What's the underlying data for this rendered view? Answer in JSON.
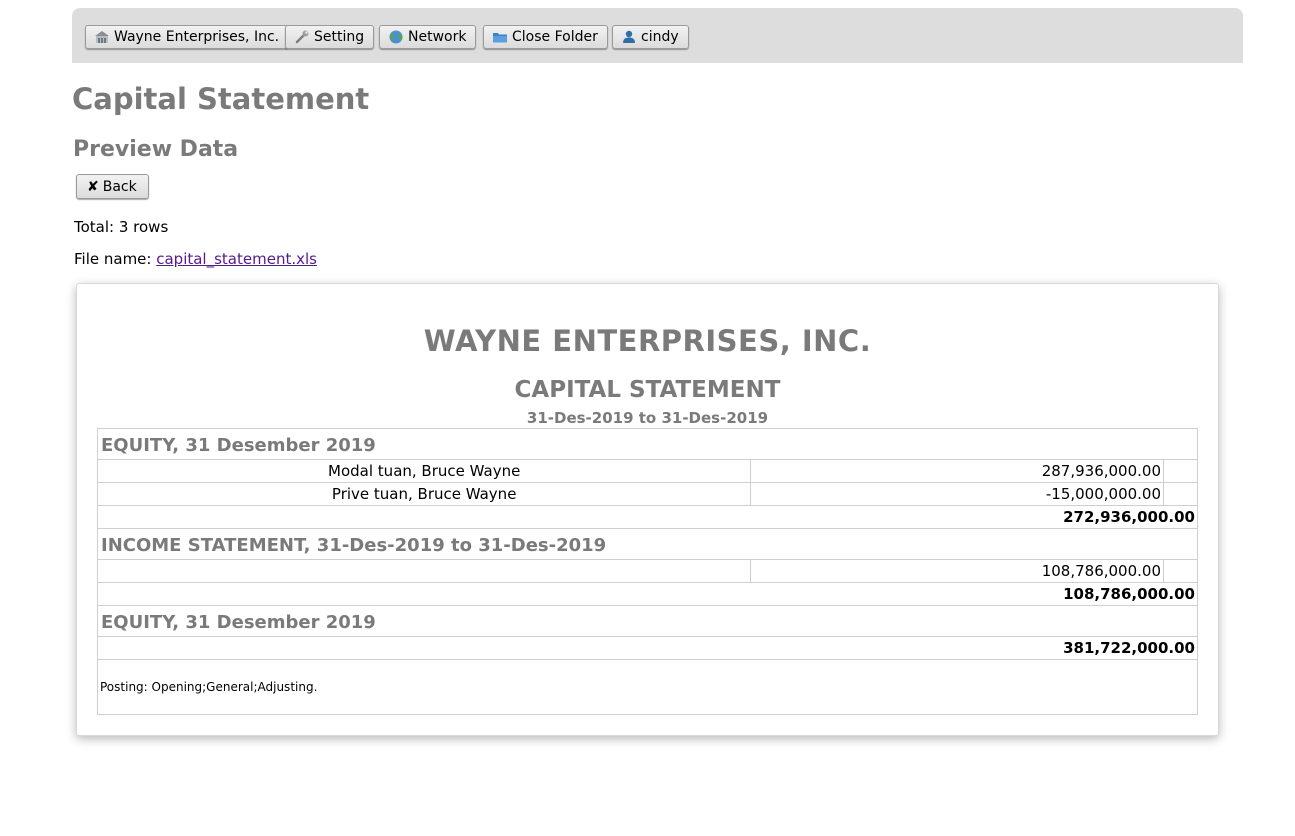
{
  "toolbar": {
    "buttons": [
      {
        "label": "Wayne Enterprises, Inc.",
        "icon": "building-icon"
      },
      {
        "label": "Setting",
        "icon": "wrench-icon"
      },
      {
        "label": "Network",
        "icon": "globe-icon"
      },
      {
        "label": "Close Folder",
        "icon": "folder-icon"
      },
      {
        "label": "cindy",
        "icon": "user-icon"
      }
    ]
  },
  "page": {
    "title": "Capital Statement",
    "subtitle": "Preview Data",
    "back_label": "Back",
    "total_text": "Total: 3 rows",
    "file_prefix": "File name: ",
    "file_name": "capital_statement.xls"
  },
  "report": {
    "company": "WAYNE ENTERPRISES, INC.",
    "title": "CAPITAL STATEMENT",
    "period": "31-Des-2019 to 31-Des-2019",
    "section1": {
      "heading": "EQUITY, 31 Desember 2019",
      "rows": [
        {
          "desc": "Modal tuan, Bruce Wayne",
          "amount": "287,936,000.00"
        },
        {
          "desc": "Prive tuan, Bruce Wayne",
          "amount": "-15,000,000.00"
        }
      ],
      "total": "272,936,000.00"
    },
    "section2": {
      "heading": "INCOME STATEMENT, 31-Des-2019 to 31-Des-2019",
      "rows": [
        {
          "desc": "",
          "amount": "108,786,000.00"
        }
      ],
      "total": "108,786,000.00"
    },
    "section3": {
      "heading": "EQUITY, 31 Desember 2019",
      "total": "381,722,000.00"
    },
    "footer": "Posting: Opening;General;Adjusting."
  },
  "colors": {
    "heading_gray": "#7a7a7a",
    "topbar_bg": "#dddddd",
    "link": "#551a8b"
  }
}
